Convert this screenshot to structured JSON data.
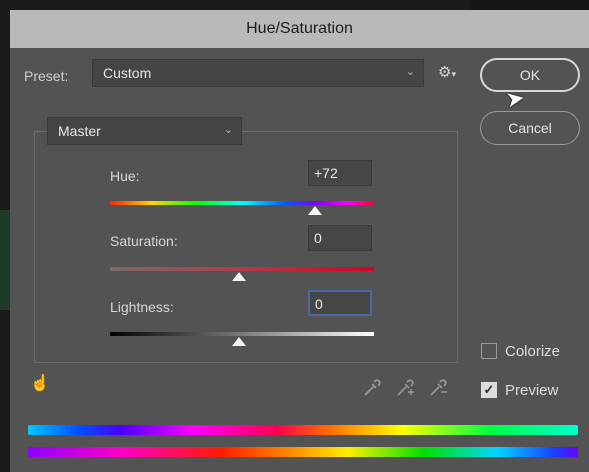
{
  "window": {
    "title": "Hue/Saturation"
  },
  "preset": {
    "label": "Preset:",
    "value": "Custom"
  },
  "buttons": {
    "ok": "OK",
    "cancel": "Cancel"
  },
  "channel": {
    "value": "Master"
  },
  "adjustments": {
    "hue": {
      "label": "Hue:",
      "value": "+72",
      "range": [
        -180,
        180
      ]
    },
    "saturation": {
      "label": "Saturation:",
      "value": "0",
      "range": [
        -100,
        100
      ]
    },
    "lightness": {
      "label": "Lightness:",
      "value": "0",
      "range": [
        -100,
        100
      ]
    }
  },
  "options": {
    "colorize": {
      "label": "Colorize",
      "checked": false
    },
    "preview": {
      "label": "Preview",
      "checked": true
    }
  },
  "icons": [
    "settings-gear-icon",
    "targeted-adjustment-hand-icon",
    "eyedropper-icon",
    "eyedropper-plus-icon",
    "eyedropper-minus-icon",
    "mouse-cursor-icon"
  ],
  "colors": {
    "dialog_bg": "#535353",
    "titlebar_bg": "#b9b9b9",
    "focus_border": "#4c67a8"
  }
}
